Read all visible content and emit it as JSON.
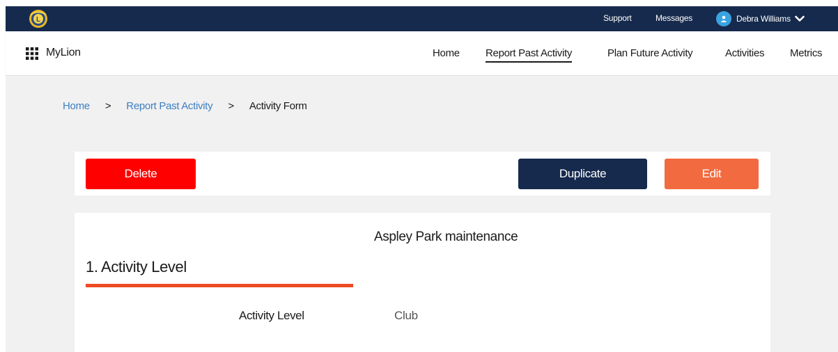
{
  "topbar": {
    "logo_icon": "lions-club-logo-icon",
    "links": [
      {
        "label": "Support"
      },
      {
        "label": "Messages"
      }
    ],
    "user": {
      "name": "Debra Williams",
      "avatar_icon": "user-avatar-icon",
      "dropdown_icon": "chevron-down-icon"
    },
    "colors": {
      "background": "#162a4d",
      "avatar": "#3aa3e0"
    }
  },
  "navbar": {
    "apps_icon": "apps-grid-icon",
    "brand": "MyLion",
    "items": [
      {
        "label": "Home",
        "active": false
      },
      {
        "label": "Report Past Activity",
        "active": true
      },
      {
        "label": "Plan Future Activity",
        "active": false
      },
      {
        "label": "Activities",
        "active": false
      },
      {
        "label": "Metrics",
        "active": false
      }
    ]
  },
  "breadcrumb": {
    "items": [
      {
        "label": "Home",
        "link": true
      },
      {
        "label": "Report Past Activity",
        "link": true
      },
      {
        "label": "Activity Form",
        "link": false
      }
    ],
    "separator": ">",
    "link_color": "#3d7fc0"
  },
  "actions": {
    "delete_label": "Delete",
    "duplicate_label": "Duplicate",
    "edit_label": "Edit",
    "colors": {
      "delete": "#fe0000",
      "duplicate": "#162a4d",
      "edit": "#f26a3f"
    }
  },
  "form": {
    "activity_title": "Aspley Park maintenance",
    "section": {
      "heading": "1. Activity Level",
      "accent_color": "#ef4b23"
    },
    "fields": [
      {
        "label": "Activity Level",
        "value": "Club"
      }
    ]
  }
}
